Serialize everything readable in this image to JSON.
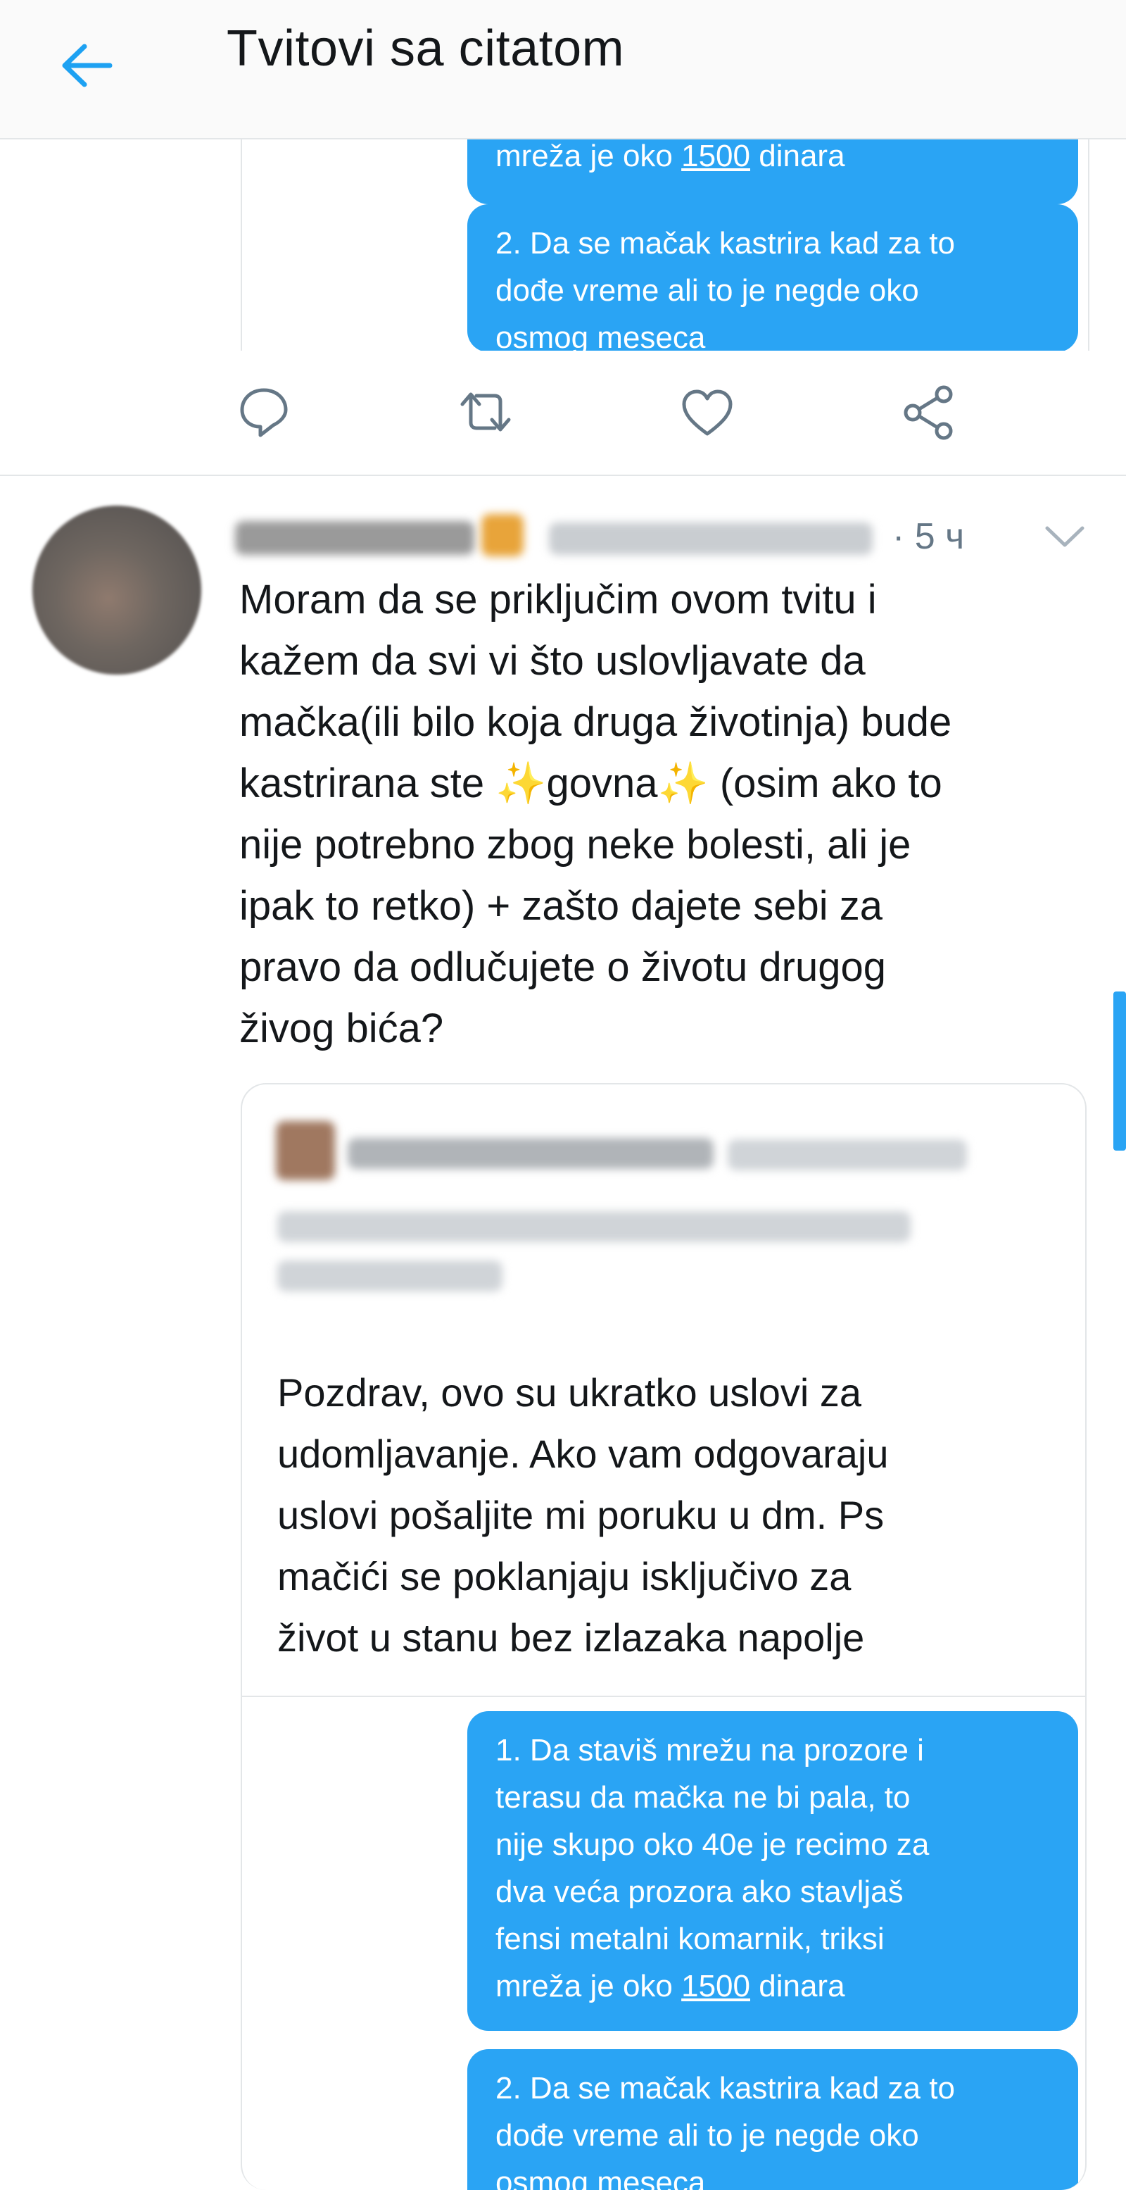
{
  "header": {
    "title": "Tvitovi sa citatom",
    "back_icon": "arrow-left-icon",
    "accent": "#1da1f2"
  },
  "top_embed": {
    "bubble1_tail": {
      "prefix": "mreža je oko ",
      "underlined": "1500",
      "suffix": " dinara"
    },
    "bubble2": {
      "line1": "2. Da se mačak kastrira kad za to",
      "line2": "dođe vreme ali to je negde oko",
      "line3": "osmog meseca"
    }
  },
  "actions": [
    {
      "name": "reply-icon"
    },
    {
      "name": "retweet-icon"
    },
    {
      "name": "like-icon"
    },
    {
      "name": "share-icon"
    }
  ],
  "tweet": {
    "time": "· 5 ч",
    "text": "Moram da se priključim ovom tvitu i\nkažem da svi vi što uslovljavate da\nmačka(ili bilo koja druga životinja) bude\nkastrirana ste ✨govna✨ (osim ako to\nnije potrebno zbog neke bolesti, ali je\nipak to retko) + zašto dajete sebi za\npravo da odlučujete o životu drugog\nživog bića?"
  },
  "quote": {
    "text": "Pozdrav, ovo su ukratko uslovi za\nudomljavanje. Ako vam odgovaraju\nuslovi pošaljite mi poruku u dm. Ps\nmačići se poklanjaju isključivo za\nživot u stanu bez izlazaka napolje",
    "bubble1": {
      "line1": "1. Da staviš mrežu na prozore i",
      "line2": "terasu da  mačka ne bi pala, to",
      "line3": "nije skupo oko 40e je recimo za",
      "line4": "dva veća prozora ako stavljaš",
      "line5": "fensi metalni komarnik, triksi",
      "line6_prefix": "mreža je oko ",
      "line6_underlined": "1500",
      "line6_suffix": " dinara"
    },
    "bubble2": {
      "line1": "2. Da se mačak kastrira kad za to",
      "line2": "dođe vreme ali to je negde oko",
      "line3": "osmog meseca"
    }
  },
  "colors": {
    "bubble": "#2aa4f4",
    "border": "#e3e6e8",
    "muted": "#657786"
  }
}
